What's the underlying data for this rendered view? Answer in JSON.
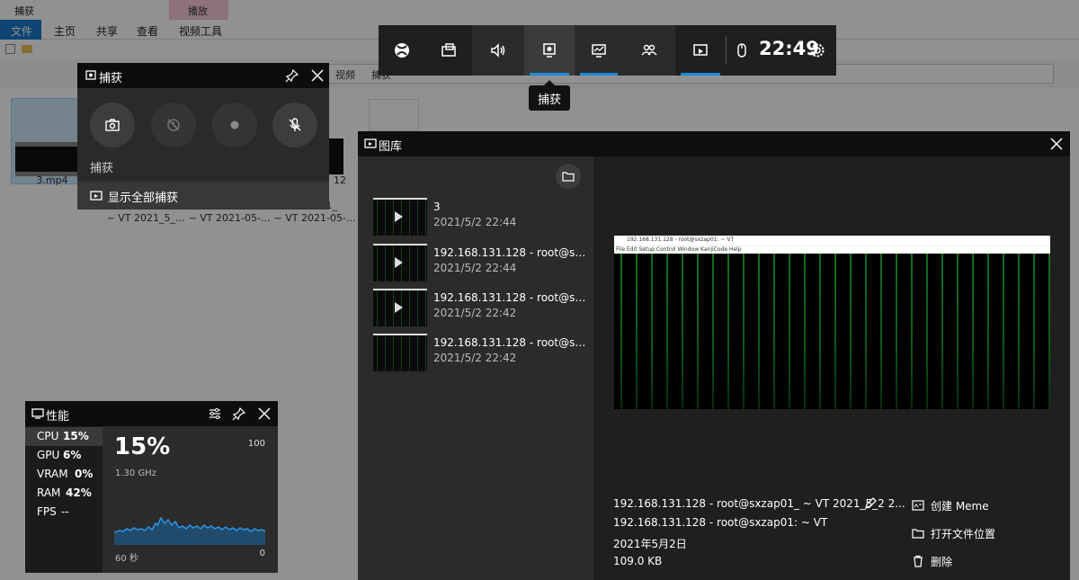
{
  "explorer": {
    "title": "捕获",
    "ribbon_tabs": {
      "file": "文件",
      "home": "主页",
      "share": "共享",
      "view": "查看",
      "play_context": "播放",
      "video_tools": "视频工具"
    },
    "address_parts": [
      "视频",
      "捕获"
    ],
    "files": [
      {
        "name": "3.mp4"
      },
      {
        "name": "~ VT 2021_5_..."
      },
      {
        "name": "~ VT 2021-05-..."
      },
      {
        "name": "~ VT 2021-05-..."
      }
    ],
    "partial_labels": {
      "b": "01_",
      "c": "12"
    }
  },
  "gamebar": {
    "clock": "22:49",
    "tooltip": "捕获",
    "buttons": [
      {
        "icon": "xbox-icon"
      },
      {
        "icon": "widget-store-icon"
      },
      {
        "icon": "audio-icon"
      },
      {
        "icon": "capture-icon"
      },
      {
        "icon": "performance-icon"
      },
      {
        "icon": "social-icon"
      },
      {
        "icon": "gallery-icon"
      }
    ]
  },
  "capture": {
    "title": "捕获",
    "label": "捕获",
    "show_all": "显示全部捕获"
  },
  "performance": {
    "title": "性能",
    "metrics": [
      {
        "k": "CPU",
        "v": "15%"
      },
      {
        "k": "GPU",
        "v": "6%"
      },
      {
        "k": "VRAM",
        "v": "0%"
      },
      {
        "k": "RAM",
        "v": "42%"
      },
      {
        "k": "FPS",
        "v": "--"
      }
    ],
    "big": "15%",
    "freq": "1.30 GHz",
    "max": "100",
    "min": "0",
    "span": "60 秒",
    "accent": "#1e8ad8"
  },
  "gallery": {
    "title": "图库",
    "items": [
      {
        "name": "3",
        "date": "2021/5/2 22:44"
      },
      {
        "name": "192.168.131.128 - root@sxzap...",
        "date": "2021/5/2 22:44"
      },
      {
        "name": "192.168.131.128 - root@sxzap...",
        "date": "2021/5/2 22:42"
      },
      {
        "name": "192.168.131.128 - root@sxzap...",
        "date": "2021/5/2 22:42"
      }
    ],
    "preview": {
      "window_title": "192.168.131.128 - root@sxzap01: ~ VT",
      "menu": "File  Edit  Setup  Control  Window  KanjiCode  Help"
    },
    "info": {
      "file_name": "192.168.131.128 - root@sxzap01_ ~ VT 2021_5_2 2...",
      "source": "192.168.131.128 - root@sxzap01: ~ VT",
      "date": "2021年5月2日",
      "size": "109.0 KB"
    },
    "actions": {
      "meme": "创建 Meme",
      "open_location": "打开文件位置",
      "delete": "删除"
    }
  }
}
